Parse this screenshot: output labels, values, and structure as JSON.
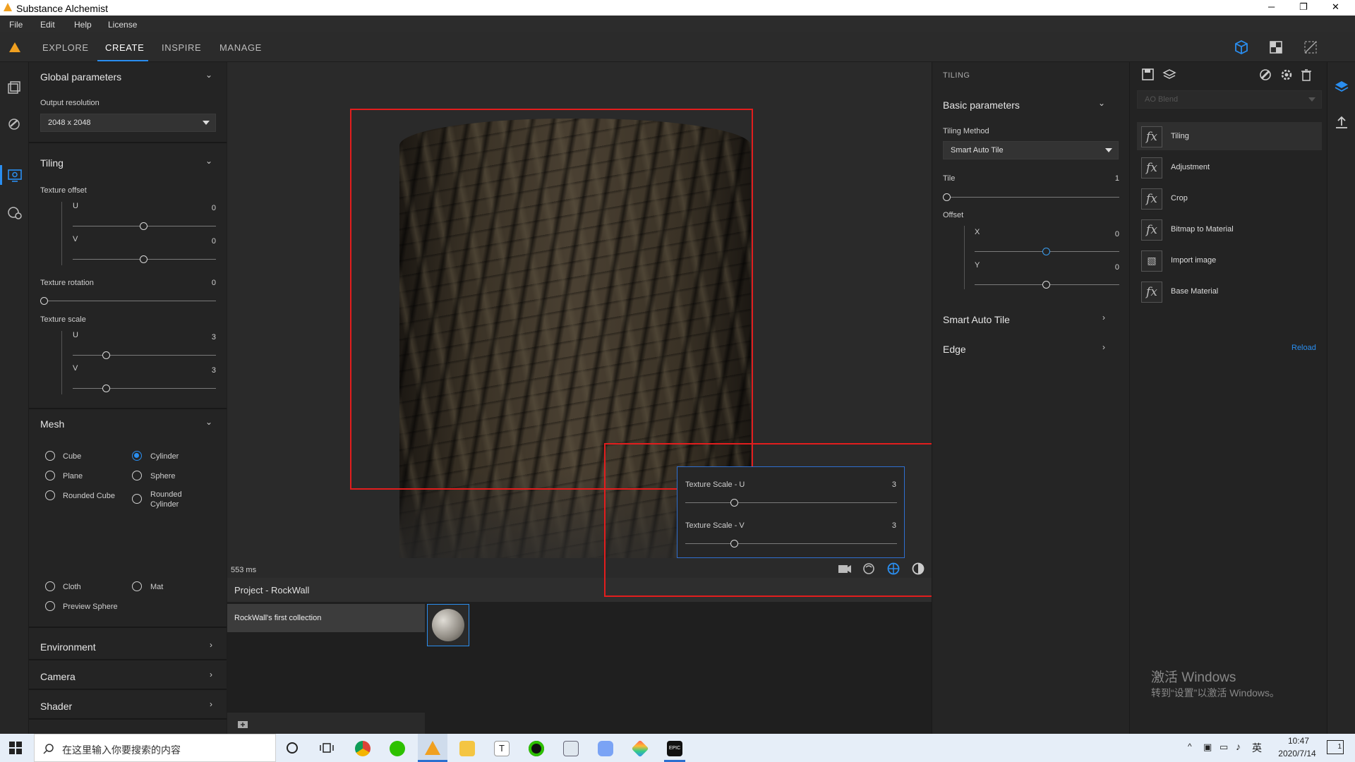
{
  "window": {
    "title": "Substance Alchemist",
    "controls": {
      "minimize": "─",
      "restore": "❐",
      "close": "✕"
    }
  },
  "menu": [
    "File",
    "Edit",
    "Help",
    "License"
  ],
  "tabs": [
    {
      "label": "EXPLORE"
    },
    {
      "label": "CREATE",
      "active": true
    },
    {
      "label": "INSPIRE"
    },
    {
      "label": "MANAGE"
    }
  ],
  "left": {
    "global": {
      "title": "Global parameters",
      "output_label": "Output resolution",
      "output_value": "2048 x 2048"
    },
    "tiling": {
      "title": "Tiling",
      "offset_label": "Texture offset",
      "u_label": "U",
      "u_value": "0",
      "v_label": "V",
      "v_value": "0",
      "rotation_label": "Texture rotation",
      "rotation_value": "0",
      "scale_label": "Texture scale",
      "su_label": "U",
      "su_value": "3",
      "sv_label": "V",
      "sv_value": "3"
    },
    "mesh": {
      "title": "Mesh",
      "options": [
        "Cube",
        "Cylinder",
        "Plane",
        "Sphere",
        "Rounded Cube",
        "Rounded Cylinder",
        "Cloth",
        "Mat",
        "Preview Sphere"
      ],
      "selected": "Cylinder"
    },
    "environment": "Environment",
    "camera": "Camera",
    "shader": "Shader"
  },
  "viewport": {
    "render_time": "553 ms"
  },
  "popup": {
    "u_label": "Texture Scale - U",
    "u_value": "3",
    "v_label": "Texture Scale - V",
    "v_value": "3"
  },
  "project": {
    "title": "Project - RockWall",
    "collection": "RockWall's first collection"
  },
  "tiling_panel": {
    "header": "TILING",
    "basic": "Basic parameters",
    "method_label": "Tiling Method",
    "method_value": "Smart Auto Tile",
    "tile_label": "Tile",
    "tile_value": "1",
    "offset_label": "Offset",
    "x_label": "X",
    "x_value": "0",
    "y_label": "Y",
    "y_value": "0",
    "smart": "Smart Auto Tile",
    "edge": "Edge"
  },
  "layers": {
    "blend": "AO Blend",
    "items": [
      "Tiling",
      "Adjustment",
      "Crop",
      "Bitmap to Material",
      "Import image",
      "Base Material"
    ],
    "reload": "Reload"
  },
  "watermark": {
    "line1": "激活 Windows",
    "line2": "转到“设置”以激活 Windows。"
  },
  "taskbar": {
    "search": "在这里输入你要搜索的内容",
    "time": "10:47",
    "date": "2020/7/14",
    "lang": "英",
    "notif": "1"
  },
  "colors": {
    "accent": "#2a8ef0",
    "highlight": "#e21d1d"
  }
}
